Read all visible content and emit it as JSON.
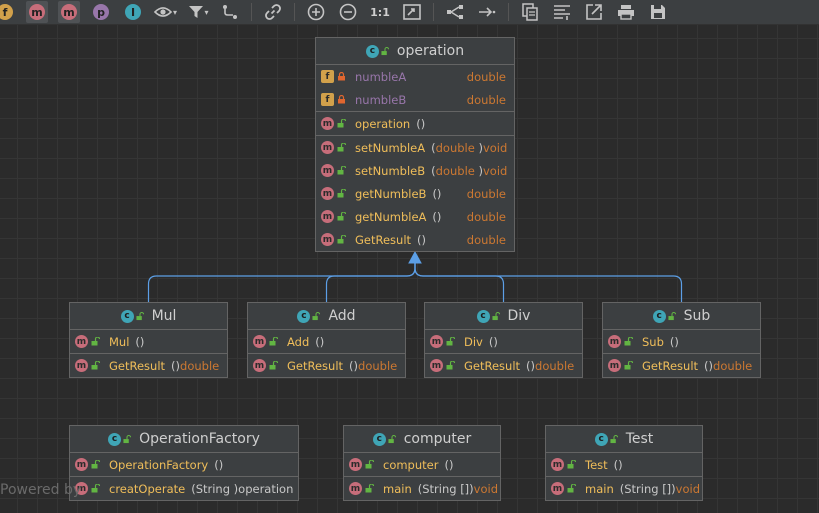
{
  "toolbar": {
    "buttons": [
      {
        "name": "fields-toggle-icon",
        "glyph": "f",
        "color": "#d2a14b",
        "active": false
      },
      {
        "name": "constructors-toggle-icon",
        "glyph": "m",
        "color": "#c76d7a",
        "active": true
      },
      {
        "name": "methods-toggle-icon",
        "glyph": "m",
        "color": "#c76d7a",
        "active": true
      },
      {
        "name": "properties-toggle-icon",
        "glyph": "p",
        "color": "#9876aa",
        "active": false
      },
      {
        "name": "inner-classes-toggle-icon",
        "glyph": "I",
        "color": "#3fa5b6",
        "active": false
      }
    ],
    "zoom_actual_label": "1:1"
  },
  "diagram": {
    "classes": [
      {
        "id": "operation",
        "name": "operation",
        "sections": [
          [
            {
              "kind": "field",
              "vis": "private",
              "name": "numbleA",
              "params": "",
              "ret": "double"
            },
            {
              "kind": "field",
              "vis": "private",
              "name": "numbleB",
              "params": "",
              "ret": "double"
            }
          ],
          [
            {
              "kind": "method",
              "vis": "public",
              "name": "operation",
              "params": "()",
              "ret": ""
            }
          ],
          [
            {
              "kind": "method",
              "vis": "public",
              "name": "setNumbleA",
              "params": "(double )",
              "ret": "void"
            },
            {
              "kind": "method",
              "vis": "public",
              "name": "setNumbleB",
              "params": "(double )",
              "ret": "void"
            },
            {
              "kind": "method",
              "vis": "public",
              "name": "getNumbleB",
              "params": "()",
              "ret": "double"
            },
            {
              "kind": "method",
              "vis": "public",
              "name": "getNumbleA",
              "params": "()",
              "ret": "double"
            },
            {
              "kind": "method",
              "vis": "public",
              "name": "GetResult",
              "params": "()",
              "ret": "double"
            }
          ]
        ]
      },
      {
        "id": "mul",
        "name": "Mul",
        "sections": [
          [
            {
              "kind": "method",
              "vis": "public",
              "name": "Mul",
              "params": "()",
              "ret": ""
            }
          ],
          [
            {
              "kind": "method",
              "vis": "public",
              "name": "GetResult",
              "params": "()",
              "ret": "double"
            }
          ]
        ]
      },
      {
        "id": "add",
        "name": "Add",
        "sections": [
          [
            {
              "kind": "method",
              "vis": "public",
              "name": "Add",
              "params": "()",
              "ret": ""
            }
          ],
          [
            {
              "kind": "method",
              "vis": "public",
              "name": "GetResult",
              "params": "()",
              "ret": "double"
            }
          ]
        ]
      },
      {
        "id": "div",
        "name": "Div",
        "sections": [
          [
            {
              "kind": "method",
              "vis": "public",
              "name": "Div",
              "params": "()",
              "ret": ""
            }
          ],
          [
            {
              "kind": "method",
              "vis": "public",
              "name": "GetResult",
              "params": "()",
              "ret": "double"
            }
          ]
        ]
      },
      {
        "id": "sub",
        "name": "Sub",
        "sections": [
          [
            {
              "kind": "method",
              "vis": "public",
              "name": "Sub",
              "params": "()",
              "ret": ""
            }
          ],
          [
            {
              "kind": "method",
              "vis": "public",
              "name": "GetResult",
              "params": "()",
              "ret": "double"
            }
          ]
        ]
      },
      {
        "id": "factory",
        "name": "OperationFactory",
        "sections": [
          [
            {
              "kind": "method",
              "vis": "public",
              "name": "OperationFactory",
              "params": "()",
              "ret": ""
            }
          ],
          [
            {
              "kind": "method",
              "vis": "public",
              "static": true,
              "name": "creatOperate",
              "params": "(String )",
              "ret": "operation",
              "ret_plain": true
            }
          ]
        ]
      },
      {
        "id": "computer",
        "name": "computer",
        "sections": [
          [
            {
              "kind": "method",
              "vis": "public",
              "name": "computer",
              "params": "()",
              "ret": ""
            }
          ],
          [
            {
              "kind": "method",
              "vis": "public",
              "static": true,
              "name": "main",
              "params": "(String [])",
              "ret": "void"
            }
          ]
        ]
      },
      {
        "id": "test",
        "name": "Test",
        "sections": [
          [
            {
              "kind": "method",
              "vis": "public",
              "name": "Test",
              "params": "()",
              "ret": ""
            }
          ],
          [
            {
              "kind": "method",
              "vis": "public",
              "static": true,
              "name": "main",
              "params": "(String [])",
              "ret": "void"
            }
          ]
        ]
      }
    ],
    "inheritance": [
      {
        "child": "mul",
        "parent": "operation"
      },
      {
        "child": "add",
        "parent": "operation"
      },
      {
        "child": "div",
        "parent": "operation"
      },
      {
        "child": "sub",
        "parent": "operation"
      }
    ]
  },
  "watermark": "Powered by",
  "colors": {
    "method_icon": "#c76d7a",
    "field_icon": "#d2a14b",
    "class_icon": "#3fa5b6",
    "member_name": "#f0be5a",
    "field_name": "#9876aa",
    "type_keyword": "#cc7832",
    "arrow": "#5c9fe6"
  }
}
